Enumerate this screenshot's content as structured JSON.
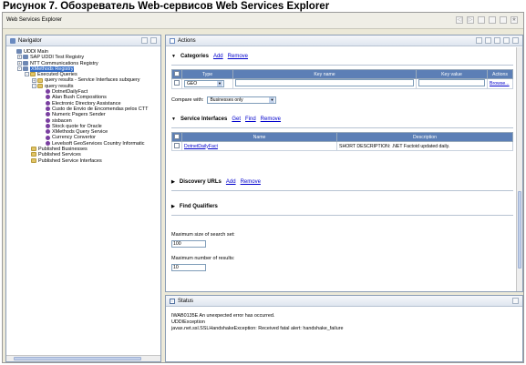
{
  "caption": "Рисунок 7. Обозреватель Web-сервисов Web Services Explorer",
  "window": {
    "title": "Web Services Explorer"
  },
  "navigator": {
    "title": "Navigator",
    "tree": [
      {
        "label": "UDDI Main",
        "level": 0,
        "expander": "",
        "icon": "uddi-main-icon",
        "kind": "reg"
      },
      {
        "label": "SAP UDDI Test Registry",
        "level": 1,
        "expander": "+",
        "icon": "registry-icon",
        "kind": "reg"
      },
      {
        "label": "NTT Communications Registry",
        "level": 1,
        "expander": "+",
        "icon": "registry-icon",
        "kind": "reg"
      },
      {
        "label": "XMethods Registry",
        "level": 1,
        "expander": "-",
        "icon": "registry-icon",
        "kind": "reg",
        "selected": true
      },
      {
        "label": "Executed Queries",
        "level": 2,
        "expander": "-",
        "icon": "folder-icon",
        "kind": "folder"
      },
      {
        "label": "query results - Service Interfaces subquery",
        "level": 3,
        "expander": "+",
        "icon": "folder-icon",
        "kind": "folder"
      },
      {
        "label": "query results",
        "level": 3,
        "expander": "-",
        "icon": "folder-icon",
        "kind": "folder"
      },
      {
        "label": "DotnetDailyFact",
        "level": 4,
        "expander": "",
        "icon": "business-icon",
        "kind": "bean"
      },
      {
        "label": "Alan Bush Compositions",
        "level": 4,
        "expander": "",
        "icon": "business-icon",
        "kind": "bean"
      },
      {
        "label": "Electronic Directory Assistance",
        "level": 4,
        "expander": "",
        "icon": "business-icon",
        "kind": "bean"
      },
      {
        "label": "Custo de Envio de Encomendas pelos CTT",
        "level": 4,
        "expander": "",
        "icon": "business-icon",
        "kind": "bean"
      },
      {
        "label": "Numeric Pagers Sender",
        "level": 4,
        "expander": "",
        "icon": "business-icon",
        "kind": "bean"
      },
      {
        "label": "sisbacen",
        "level": 4,
        "expander": "",
        "icon": "business-icon",
        "kind": "bean"
      },
      {
        "label": "Stock quote for Oracle",
        "level": 4,
        "expander": "",
        "icon": "business-icon",
        "kind": "bean"
      },
      {
        "label": "XMethods Query Service",
        "level": 4,
        "expander": "",
        "icon": "business-icon",
        "kind": "bean"
      },
      {
        "label": "Currency Convertor",
        "level": 4,
        "expander": "",
        "icon": "business-icon",
        "kind": "bean"
      },
      {
        "label": "Levelsoft GeoServices Country Informatic",
        "level": 4,
        "expander": "",
        "icon": "business-icon",
        "kind": "bean"
      },
      {
        "label": "Published Businesses",
        "level": 2,
        "expander": "",
        "icon": "folder-icon",
        "kind": "folder"
      },
      {
        "label": "Published Services",
        "level": 2,
        "expander": "",
        "icon": "folder-icon",
        "kind": "folder"
      },
      {
        "label": "Published Service Interfaces",
        "level": 2,
        "expander": "",
        "icon": "folder-icon",
        "kind": "folder"
      }
    ]
  },
  "actions": {
    "title": "Actions",
    "categories": {
      "title": "Categories",
      "add": "Add",
      "remove": "Remove",
      "headers": {
        "type": "Type",
        "key_name": "Key name",
        "key_value": "Key value",
        "actions": "Actions"
      },
      "row": {
        "type": "GEO",
        "browse": "Browse..."
      }
    },
    "compare_with": {
      "label": "Compare with:",
      "value": "Businesses only"
    },
    "service_interfaces": {
      "title": "Service Interfaces",
      "get": "Get",
      "find": "Find",
      "remove": "Remove",
      "headers": {
        "name": "Name",
        "description": "Description"
      },
      "row": {
        "name": "DotnetDailyFact",
        "description": "SHORT DESCRIPTION: .NET Factoid updated daily."
      }
    },
    "discovery_urls": {
      "title": "Discovery URLs",
      "add": "Add",
      "remove": "Remove"
    },
    "find_qualifiers": {
      "title": "Find Qualifiers"
    },
    "max_search_set": {
      "label": "Maximum size of search set:",
      "value": "100"
    },
    "max_results": {
      "label": "Maximum number of results:",
      "value": "10"
    }
  },
  "status": {
    "title": "Status",
    "lines": [
      "IWAB0135E An unexpected error has occurred.",
      "UDDIException",
      "javax.net.ssl.SSLHandshakeException: Received fatal alert: handshake_failure"
    ]
  }
}
